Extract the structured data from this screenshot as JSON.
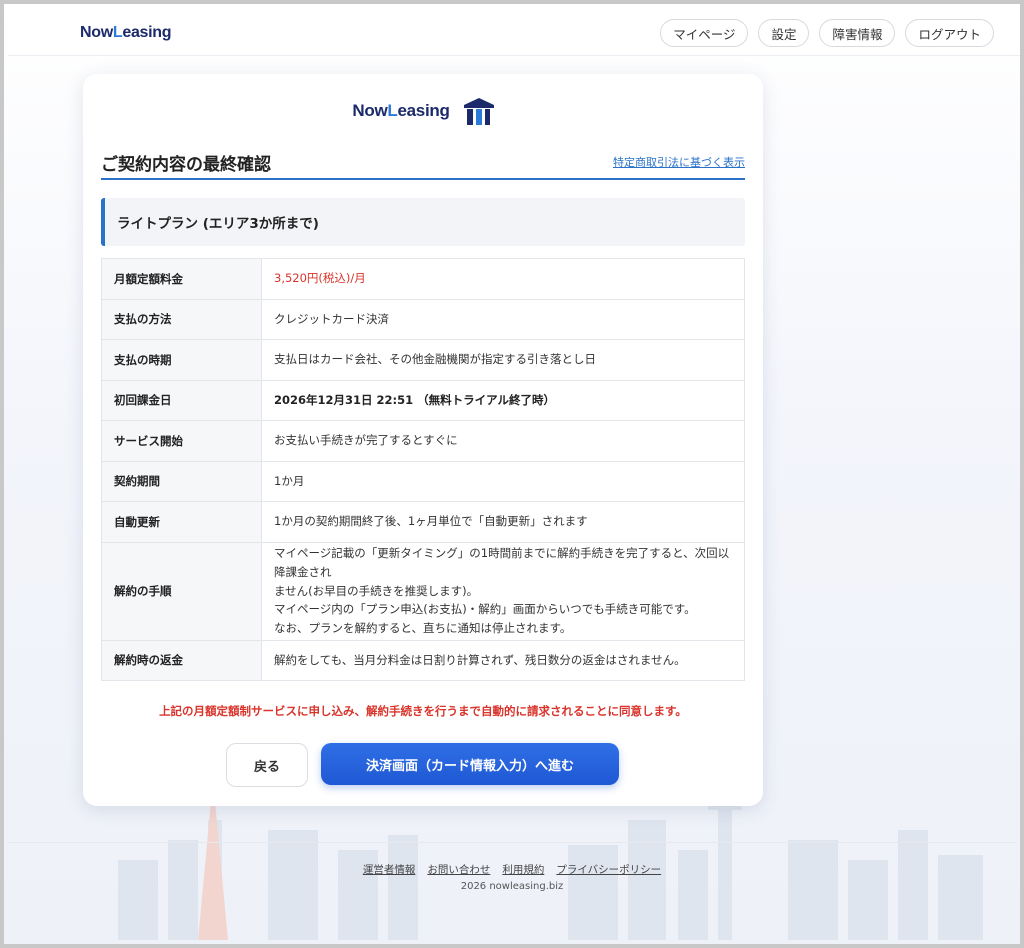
{
  "brand": {
    "logo_text_pre": "Now",
    "logo_text_l": "L",
    "logo_text_post": "easing"
  },
  "nav": {
    "items": [
      {
        "label": "マイページ"
      },
      {
        "label": "設定"
      },
      {
        "label": "障害情報"
      },
      {
        "label": "ログアウト"
      }
    ]
  },
  "main": {
    "title": "ご契約内容の最終確認",
    "law_link": "特定商取引法に基づく表示",
    "plan_name": "ライトプラン (エリア3か所まで)",
    "rows": [
      {
        "key": "月額定額料金",
        "value": "3,520円(税込)/月"
      },
      {
        "key": "支払の方法",
        "value": "クレジットカード決済"
      },
      {
        "key": "支払の時期",
        "value": "支払日はカード会社、その他金融機関が指定する引き落とし日"
      },
      {
        "key": "初回課金日",
        "value": "2026年12月31日 22:51 （無料トライアル終了時）"
      },
      {
        "key": "サービス開始",
        "value": "お支払い手続きが完了するとすぐに"
      },
      {
        "key": "契約期間",
        "value": "1か月"
      },
      {
        "key": "自動更新",
        "value": "1か月の契約期間終了後、1ヶ月単位で「自動更新」されます"
      },
      {
        "key": "解約の手順",
        "value_lines": [
          "マイページ記載の「更新タイミング」の1時間前までに解約手続きを完了すると、次回以降課金され",
          "ません(お早目の手続きを推奨します)。",
          "マイページ内の「プラン申込(お支払)・解約」画面からいつでも手続き可能です。",
          "なお、プランを解約すると、直ちに通知は停止されます。"
        ]
      },
      {
        "key": "解約時の返金",
        "value": "解約をしても、当月分料金は日割り計算されず、残日数分の返金はされません。"
      }
    ],
    "consent": "上記の月額定額制サービスに申し込み、解約手続きを行うまで自動的に請求されることに同意します。",
    "back_label": "戻る",
    "proceed_label": "決済画面（カード情報入力）へ進む"
  },
  "footer": {
    "links": [
      {
        "label": "運営者情報"
      },
      {
        "label": "お問い合わせ"
      },
      {
        "label": "利用規約"
      },
      {
        "label": "プライバシーポリシー"
      }
    ],
    "copyright": "2026 nowleasing.biz"
  },
  "colors": {
    "accent": "#2a72c8",
    "primary_button": "#2565dd",
    "warning_text": "#d9342b",
    "brand_navy": "#1c2a6b"
  }
}
